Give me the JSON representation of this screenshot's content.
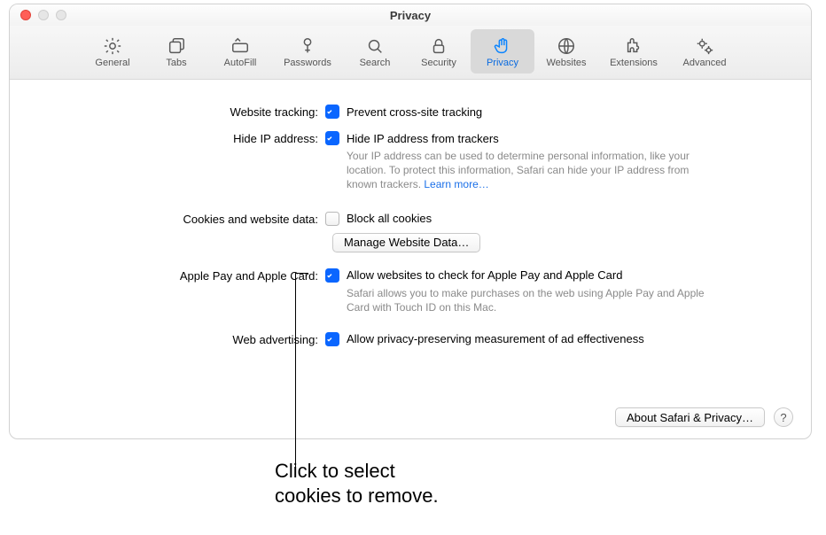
{
  "window": {
    "title": "Privacy"
  },
  "tabs": [
    {
      "label": "General"
    },
    {
      "label": "Tabs"
    },
    {
      "label": "AutoFill"
    },
    {
      "label": "Passwords"
    },
    {
      "label": "Search"
    },
    {
      "label": "Security"
    },
    {
      "label": "Privacy"
    },
    {
      "label": "Websites"
    },
    {
      "label": "Extensions"
    },
    {
      "label": "Advanced"
    }
  ],
  "sections": {
    "tracking": {
      "label": "Website tracking:",
      "option": "Prevent cross-site tracking"
    },
    "hideip": {
      "label": "Hide IP address:",
      "option": "Hide IP address from trackers",
      "desc": "Your IP address can be used to determine personal information, like your location. To protect this information, Safari can hide your IP address from known trackers. ",
      "learn": "Learn more…"
    },
    "cookies": {
      "label": "Cookies and website data:",
      "option": "Block all cookies",
      "manage": "Manage Website Data…"
    },
    "applepay": {
      "label": "Apple Pay and Apple Card:",
      "option": "Allow websites to check for Apple Pay and Apple Card",
      "desc": "Safari allows you to make purchases on the web using Apple Pay and Apple Card with Touch ID on this Mac."
    },
    "advertising": {
      "label": "Web advertising:",
      "option": "Allow privacy-preserving measurement of ad effectiveness"
    }
  },
  "footer": {
    "about": "About Safari & Privacy…",
    "help": "?"
  },
  "callout": {
    "line1": "Click to select",
    "line2": "cookies to remove."
  }
}
